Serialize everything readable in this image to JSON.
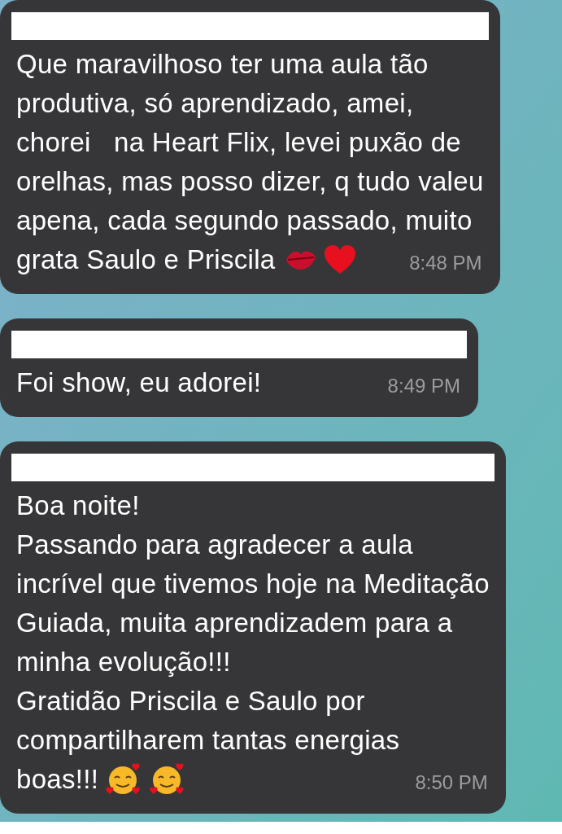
{
  "messages": [
    {
      "lines": [
        "Que maravilhoso ter uma aula tão",
        "produtiva, só aprendizado, amei,",
        "chorei   na Heart Flix, levei puxão de",
        "orelhas, mas posso dizer, q tudo valeu",
        "apena, cada segundo passado, muito",
        "grata Saulo e Priscila"
      ],
      "emojis": [
        {
          "kind": "kiss"
        },
        {
          "kind": "heart"
        }
      ],
      "time": "8:48 PM"
    },
    {
      "lines": [
        "Foi show, eu adorei!"
      ],
      "time": "8:49 PM"
    },
    {
      "lines": [
        "Boa noite!",
        "Passando para agradecer a aula",
        "incrível que tivemos hoje na Meditação",
        "Guiada, muita aprendizadem para a",
        "minha evolução!!!",
        "Gratidão Priscila e Saulo por",
        "compartilharem tantas energias",
        "boas!!!"
      ],
      "emojis": [
        {
          "kind": "love-face"
        },
        {
          "kind": "love-face"
        }
      ],
      "time": "8:50 PM"
    }
  ]
}
